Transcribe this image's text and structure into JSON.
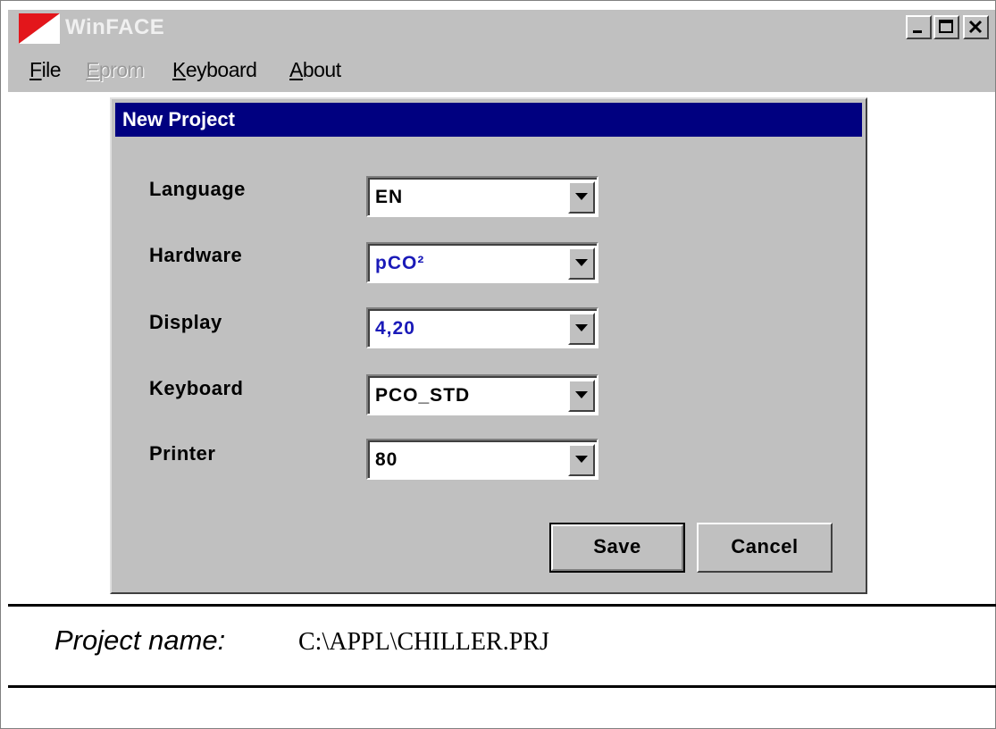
{
  "window": {
    "title": "WinFACE"
  },
  "menu": [
    {
      "label": "File",
      "disabled": false
    },
    {
      "label": "Eprom",
      "disabled": true
    },
    {
      "label": "Keyboard",
      "disabled": false
    },
    {
      "label": "About",
      "disabled": false
    }
  ],
  "dialog": {
    "title": "New Project",
    "fields": [
      {
        "label": "Language",
        "value": "EN",
        "value_color": "#000000"
      },
      {
        "label": "Hardware",
        "value": "pCO²",
        "value_color": "#1a1ab8"
      },
      {
        "label": "Display",
        "value": "4,20",
        "value_color": "#1a1ab8"
      },
      {
        "label": "Keyboard",
        "value": "PCO_STD",
        "value_color": "#000000"
      },
      {
        "label": "Printer",
        "value": "80",
        "value_color": "#000000"
      }
    ],
    "save_label": "Save",
    "cancel_label": "Cancel"
  },
  "project": {
    "label": "Project name:",
    "value": "C:\\APPL\\CHILLER.PRJ"
  },
  "icons": {
    "app": "winface-logo-icon",
    "minimize": "minimize-icon",
    "maximize": "maximize-icon",
    "close": "close-icon",
    "dropdown": "dropdown-arrow-icon"
  },
  "colors": {
    "titlebar_inactive": "#c0c0c0",
    "dialog_titlebar": "#000080",
    "logo_red": "#e3161b"
  }
}
